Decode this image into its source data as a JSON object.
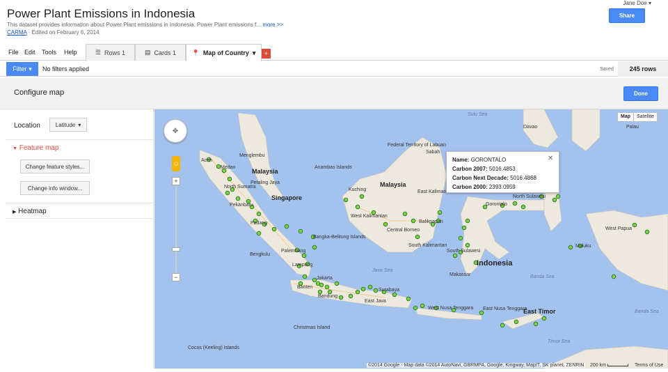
{
  "header": {
    "title": "Power Plant Emissions in Indonesia",
    "description": "This dataset provides information about Power Plant emissions in Indonesia. Power Plant emissions f...",
    "more_link": "more >>",
    "owner": "CARMA",
    "separator": "·",
    "edited": "Edited on February 6, 2014",
    "user": "Jane Doe",
    "share_label": "Share"
  },
  "menu": {
    "items": [
      "File",
      "Edit",
      "Tools",
      "Help"
    ]
  },
  "tabs": [
    {
      "label": "Rows 1",
      "icon": "rows-icon"
    },
    {
      "label": "Cards 1",
      "icon": "cards-icon"
    },
    {
      "label": "Map of Country",
      "icon": "map-pin-icon",
      "active": true
    }
  ],
  "add_tab": "+",
  "filterbar": {
    "filter_label": "Filter",
    "no_filters": "No filters applied",
    "saved": "Saved",
    "rows": "245 rows"
  },
  "config": {
    "title": "Configure map",
    "done_label": "Done"
  },
  "left_panel": {
    "location_label": "Location",
    "location_value": "Latitude",
    "feature_map": "Feature map",
    "change_styles": "Change feature styles...",
    "change_info": "Change info window...",
    "heatmap": "Heatmap"
  },
  "map": {
    "type_map": "Map",
    "type_satellite": "Satellite",
    "infowindow": {
      "name_label": "Name:",
      "name_value": "GORONTALO",
      "carbon2007_label": "Carbon 2007:",
      "carbon2007_value": "5016.4853",
      "carbon_next_label": "Carbon Next Decade:",
      "carbon_next_value": "5016.4868",
      "carbon2000_label": "Carbon 2000:",
      "carbon2000_value": "2393.0959"
    },
    "footer": "©2014 Google - Map data ©2014 AutoNavi, GBRMPA, Google, Kingway, MapIT, SK planet, ZENRIN",
    "scale": "200 km",
    "terms": "Terms of Use",
    "labels": {
      "sulu_sea": "Sulu Sea",
      "davao": "Davao",
      "palau": "Palau",
      "aceh": "Aceh",
      "medan": "Medan",
      "menglembu": "Menglembu",
      "malaysia_w": "Malaysia",
      "anambas": "Anambas Islands",
      "kuching": "Kuching",
      "malaysia_e": "Malaysia",
      "federal_territory": "Federal Territory of Labuan",
      "sabah": "Sabah",
      "east_kalimantan": "East Kalimantan",
      "north_sulawesi": "North Sulawesi",
      "petaling": "Petaling Jaya",
      "north_sumatra": "North Sumatra",
      "singapore": "Singapore",
      "pekanbaru": "Pekanbaru",
      "padang": "Padang",
      "west_kalimantan": "West Kalimantan",
      "balikpapan": "Balikpapan",
      "central_borneo": "Central Borneo",
      "bangka": "Bangka-Belitung Islands",
      "palembang": "Palembang",
      "south_kalimantan": "South Kalimantan",
      "south_sulawesi": "South Sulawesi",
      "indonesia": "Indonesia",
      "maluku": "Maluku",
      "west_papua": "West Papua",
      "bengkulu": "Bengkulu",
      "lampung": "Lampung",
      "java_sea": "Java Sea",
      "banda_sea": "Banda Sea",
      "makassar": "Makassar",
      "jakarta": "Jakarta",
      "banten": "Banten",
      "bandung": "Bandung",
      "surabaya": "Surabaya",
      "east_java": "East Java",
      "west_nusa": "West Nusa Tenggara",
      "east_nusa": "East Nusa Tenggara",
      "east_timor": "East Timor",
      "banda_sea2": "Banda Sea",
      "timor_sea": "Timor Sea",
      "christmas": "Christmas Island",
      "cocos": "Cocos (Keeling) Islands",
      "gorontalo": "Gorontalo"
    }
  },
  "colors": {
    "accent_blue": "#4a8af4",
    "accent_red": "#dd4b39",
    "marker_fill": "#7cd34a",
    "marker_stroke": "#2a6f1d",
    "land": "#ede9df",
    "water": "#a4c2ee"
  }
}
